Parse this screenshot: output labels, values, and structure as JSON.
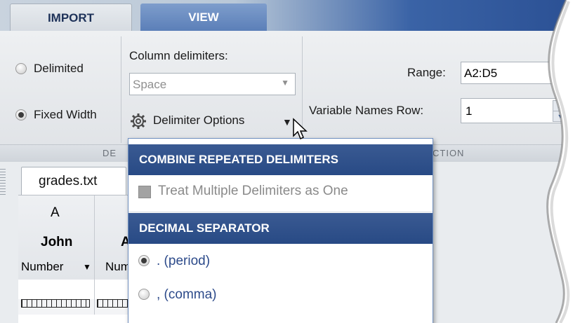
{
  "tabs": [
    {
      "label": "IMPORT",
      "active": true
    },
    {
      "label": "VIEW",
      "active": false
    }
  ],
  "ribbon": {
    "delimited_label": "Delimited",
    "fixed_width_label": "Fixed Width",
    "column_delimiters_label": "Column delimiters:",
    "column_delimiters_value": "Space",
    "delimiter_options_label": "Delimiter Options",
    "range_label": "Range:",
    "range_value": "A2:D5",
    "variable_names_row_label": "Variable Names Row:",
    "variable_names_row_value": "1",
    "section_left_fragment": "DE",
    "section_right_fragment": "CTION"
  },
  "document": {
    "file_tab": "grades.txt",
    "column_letter": "A",
    "column_name": "John",
    "column_name_next_fragment": "A",
    "column_type": "Number",
    "column_type_next_fragment": "Numl"
  },
  "menu": {
    "header_combine": "COMBINE REPEATED DELIMITERS",
    "treat_multiple": "Treat Multiple Delimiters as One",
    "header_decimal": "DECIMAL SEPARATOR",
    "period_option": ". (period)",
    "comma_option": ", (comma)",
    "period_selected": true
  },
  "colors": {
    "menu_header": "#2d4f8a",
    "menu_option_text": "#2c4a8a",
    "disabled_text": "#8a8a8a",
    "tab_bar_dark": "#2a4f93"
  }
}
